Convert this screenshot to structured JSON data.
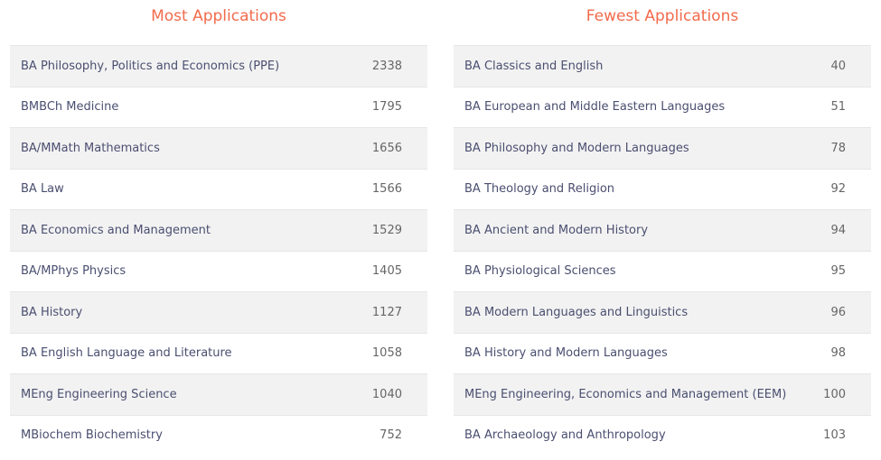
{
  "most": {
    "title": "Most Applications",
    "rows": [
      {
        "course": "BA Philosophy, Politics and Economics (PPE)",
        "count": "2338"
      },
      {
        "course": "BMBCh Medicine",
        "count": "1795"
      },
      {
        "course": "BA/MMath Mathematics",
        "count": "1656"
      },
      {
        "course": "BA Law",
        "count": "1566"
      },
      {
        "course": "BA Economics and Management",
        "count": "1529"
      },
      {
        "course": "BA/MPhys Physics",
        "count": "1405"
      },
      {
        "course": "BA History",
        "count": "1127"
      },
      {
        "course": "BA English Language and Literature",
        "count": "1058"
      },
      {
        "course": "MEng Engineering Science",
        "count": "1040"
      },
      {
        "course": "MBiochem Biochemistry",
        "count": "752"
      }
    ]
  },
  "fewest": {
    "title": "Fewest Applications",
    "rows": [
      {
        "course": "BA Classics and English",
        "count": "40"
      },
      {
        "course": "BA European and Middle Eastern Languages",
        "count": "51"
      },
      {
        "course": "BA Philosophy and Modern Languages",
        "count": "78"
      },
      {
        "course": "BA Theology and Religion",
        "count": "92"
      },
      {
        "course": "BA Ancient and Modern History",
        "count": "94"
      },
      {
        "course": "BA Physiological Sciences",
        "count": "95"
      },
      {
        "course": "BA Modern Languages and Linguistics",
        "count": "96"
      },
      {
        "course": "BA History and Modern Languages",
        "count": "98"
      },
      {
        "course": "MEng Engineering, Economics and Management (EEM)",
        "count": "100"
      },
      {
        "course": "BA Archaeology and Anthropology",
        "count": "103"
      }
    ]
  },
  "colors": {
    "title": "#f26b4c",
    "text": "#4a4f70",
    "stripe": "#f2f2f2"
  }
}
